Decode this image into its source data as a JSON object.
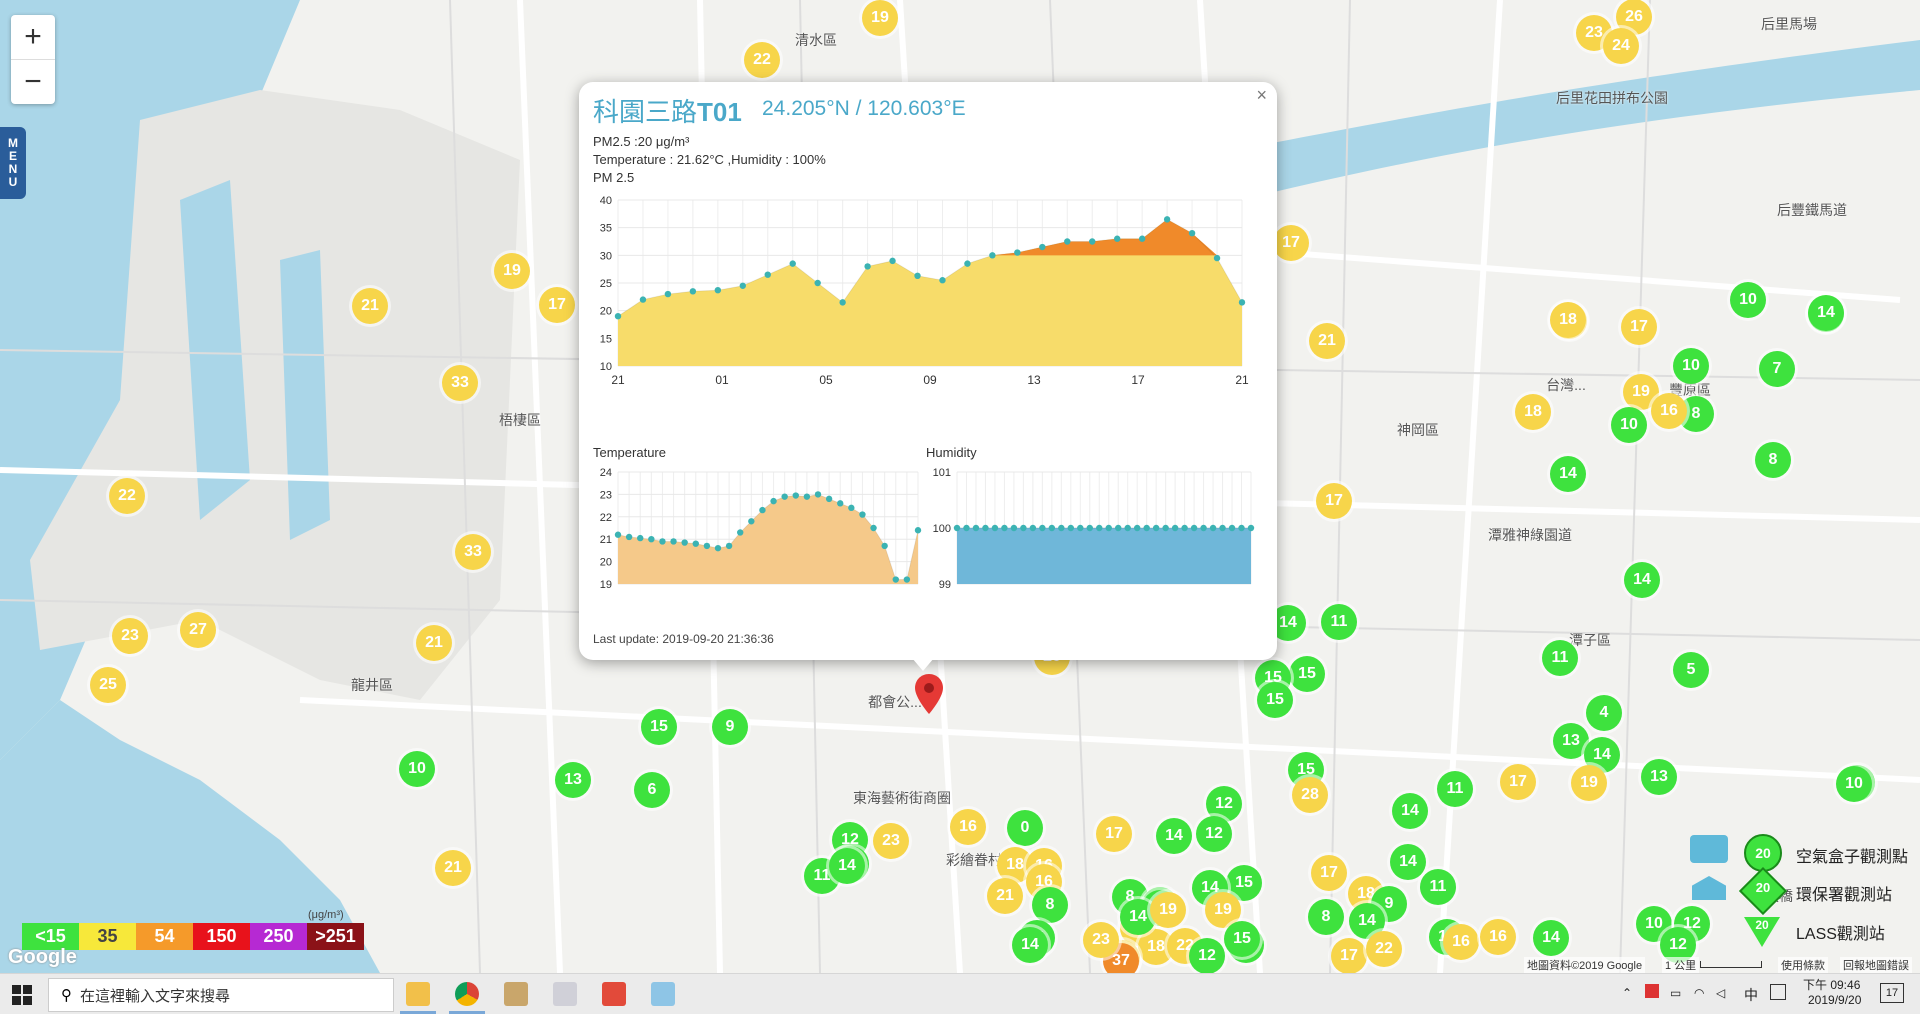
{
  "map": {
    "zoom_in": "+",
    "zoom_out": "−",
    "menu_letters": [
      "M",
      "E",
      "N",
      "U"
    ],
    "places": [
      {
        "t": "清水區"
      },
      {
        "t": "后里馬場"
      },
      {
        "t": "后里花田拼布公園"
      },
      {
        "t": "后豐鐵馬道"
      },
      {
        "t": "梧棲區"
      },
      {
        "t": "神岡區"
      },
      {
        "t": "潭雅神綠園道"
      },
      {
        "t": "台灣..."
      },
      {
        "t": "龍井區"
      },
      {
        "t": "都會公..."
      },
      {
        "t": "東海藝術街商圈"
      },
      {
        "t": "潭子區"
      },
      {
        "t": "豐原區"
      },
      {
        "t": "彩繪眷村"
      },
      {
        "t": "海天橋"
      }
    ],
    "markers": [
      {
        "v": "19",
        "c": "y"
      },
      {
        "v": "22",
        "c": "y"
      },
      {
        "v": "23",
        "c": "y"
      },
      {
        "v": "26",
        "c": "y"
      },
      {
        "v": "24",
        "c": "y"
      },
      {
        "v": "21",
        "c": "y"
      },
      {
        "v": "19",
        "c": "y"
      },
      {
        "v": "17",
        "c": "y"
      },
      {
        "v": "33",
        "c": "y"
      },
      {
        "v": "22",
        "c": "y"
      },
      {
        "v": "33",
        "c": "y"
      },
      {
        "v": "23",
        "c": "y"
      },
      {
        "v": "27",
        "c": "y"
      },
      {
        "v": "21",
        "c": "y"
      },
      {
        "v": "25",
        "c": "y"
      },
      {
        "v": "10",
        "c": "g"
      },
      {
        "v": "13",
        "c": "g"
      },
      {
        "v": "6",
        "c": "g"
      },
      {
        "v": "15",
        "c": "g"
      },
      {
        "v": "9",
        "c": "g"
      },
      {
        "v": "21",
        "c": "y"
      },
      {
        "v": "12",
        "c": "g"
      },
      {
        "v": "17",
        "c": "y"
      },
      {
        "v": "21",
        "c": "y"
      },
      {
        "v": "17",
        "c": "y"
      },
      {
        "v": "16",
        "c": "y"
      },
      {
        "v": "18",
        "c": "y"
      },
      {
        "v": "17",
        "c": "y"
      },
      {
        "v": "18",
        "c": "y"
      },
      {
        "v": "17",
        "c": "y"
      },
      {
        "v": "19",
        "c": "y"
      },
      {
        "v": "10",
        "c": "g"
      },
      {
        "v": "14",
        "c": "g"
      },
      {
        "v": "14",
        "c": "g"
      },
      {
        "v": "10",
        "c": "g"
      },
      {
        "v": "7",
        "c": "g"
      },
      {
        "v": "8",
        "c": "g"
      },
      {
        "v": "16",
        "c": "y"
      },
      {
        "v": "8",
        "c": "g"
      },
      {
        "v": "14",
        "c": "g"
      },
      {
        "v": "10",
        "c": "g"
      },
      {
        "v": "14",
        "c": "g"
      },
      {
        "v": "11",
        "c": "g"
      },
      {
        "v": "14",
        "c": "g"
      },
      {
        "v": "11",
        "c": "g"
      },
      {
        "v": "15",
        "c": "g"
      },
      {
        "v": "5",
        "c": "g"
      },
      {
        "v": "4",
        "c": "g"
      },
      {
        "v": "13",
        "c": "g"
      },
      {
        "v": "14",
        "c": "g"
      },
      {
        "v": "13",
        "c": "g"
      },
      {
        "v": "15",
        "c": "g"
      },
      {
        "v": "15",
        "c": "g"
      },
      {
        "v": "15",
        "c": "g"
      },
      {
        "v": "28",
        "c": "y"
      },
      {
        "v": "12",
        "c": "g"
      },
      {
        "v": "14",
        "c": "g"
      },
      {
        "v": "11",
        "c": "g"
      },
      {
        "v": "19",
        "c": "y"
      },
      {
        "v": "17",
        "c": "y"
      },
      {
        "v": "14",
        "c": "g"
      },
      {
        "v": "18",
        "c": "y"
      },
      {
        "v": "9",
        "c": "g"
      },
      {
        "v": "17",
        "c": "y"
      },
      {
        "v": "11",
        "c": "g"
      },
      {
        "v": "14",
        "c": "g"
      },
      {
        "v": "8",
        "c": "g"
      },
      {
        "v": "14",
        "c": "g"
      },
      {
        "v": "17",
        "c": "y"
      },
      {
        "v": "22",
        "c": "y"
      },
      {
        "v": "16",
        "c": "y"
      },
      {
        "v": "16",
        "c": "y"
      },
      {
        "v": "14",
        "c": "g"
      },
      {
        "v": "10",
        "c": "g"
      },
      {
        "v": "12",
        "c": "g"
      },
      {
        "v": "12",
        "c": "g"
      },
      {
        "v": "14",
        "c": "g"
      },
      {
        "v": "10",
        "c": "g"
      },
      {
        "v": "20",
        "c": "y"
      },
      {
        "v": "15",
        "c": "g"
      },
      {
        "v": "0",
        "c": "g"
      },
      {
        "v": "16",
        "c": "y"
      },
      {
        "v": "12",
        "c": "g"
      },
      {
        "v": "23",
        "c": "y"
      },
      {
        "v": "15",
        "c": "g"
      },
      {
        "v": "11",
        "c": "g"
      },
      {
        "v": "14",
        "c": "g"
      },
      {
        "v": "18",
        "c": "y"
      },
      {
        "v": "16",
        "c": "y"
      },
      {
        "v": "16",
        "c": "y"
      },
      {
        "v": "21",
        "c": "y"
      },
      {
        "v": "8",
        "c": "g"
      },
      {
        "v": "11",
        "c": "g"
      },
      {
        "v": "15",
        "c": "g"
      },
      {
        "v": "16",
        "c": "y"
      },
      {
        "v": "18",
        "c": "y"
      },
      {
        "v": "22",
        "c": "y"
      },
      {
        "v": "14",
        "c": "g"
      },
      {
        "v": "10",
        "c": "g"
      },
      {
        "v": "19",
        "c": "y"
      },
      {
        "v": "16",
        "c": "y"
      },
      {
        "v": "18",
        "c": "y"
      },
      {
        "v": "14",
        "c": "g"
      },
      {
        "v": "15",
        "c": "g"
      },
      {
        "v": "37",
        "c": "o"
      },
      {
        "v": "12",
        "c": "g"
      },
      {
        "v": "14",
        "c": "g"
      },
      {
        "v": "8",
        "c": "g"
      },
      {
        "v": "17",
        "c": "y"
      },
      {
        "v": "12",
        "c": "g"
      },
      {
        "v": "15",
        "c": "g"
      },
      {
        "v": "9",
        "c": "g"
      },
      {
        "v": "14",
        "c": "g"
      },
      {
        "v": "19",
        "c": "y"
      },
      {
        "v": "23",
        "c": "y"
      }
    ]
  },
  "popup": {
    "title_name": "科園三路",
    "title_id": "T01",
    "coords": "24.205°N / 120.603°E",
    "pm_line": "PM2.5 :20 μg/m³",
    "temp_line": "Temperature : 21.62°C ,Humidity : 100%",
    "pm_chart_label": "PM 2.5",
    "temp_chart_label": "Temperature",
    "hum_chart_label": "Humidity",
    "last_update": "Last update: 2019-09-20 21:36:36",
    "close": "×"
  },
  "chart_data": [
    {
      "type": "area",
      "title": "PM 2.5",
      "x": [
        "21",
        "22",
        "23",
        "00",
        "01",
        "02",
        "03",
        "04",
        "05",
        "06",
        "07",
        "08",
        "09",
        "10",
        "11",
        "12",
        "13",
        "14",
        "15",
        "16",
        "17",
        "18",
        "19",
        "20",
        "21"
      ],
      "xticks": [
        "21",
        "01",
        "05",
        "09",
        "13",
        "17",
        "21"
      ],
      "ylim": [
        10,
        40
      ],
      "yticks": [
        10,
        15,
        20,
        25,
        30,
        35,
        40
      ],
      "series": [
        {
          "values": [
            19,
            22,
            23,
            23.5,
            23.7,
            24.5,
            26.5,
            28.5,
            25,
            21.5,
            28,
            29,
            26.3,
            25.5,
            28.5,
            30,
            30.5,
            31.5,
            32.5,
            32.5,
            33,
            33,
            36.5,
            34,
            29.5,
            21.5
          ]
        }
      ],
      "colors": {
        "fill": "#f7dc6a",
        "high_fill": "#f08a2a",
        "dot": "#3bb3b3"
      }
    },
    {
      "type": "area",
      "title": "Temperature",
      "ylim": [
        19,
        24
      ],
      "yticks": [
        19,
        20,
        21,
        22,
        23,
        24
      ],
      "series": [
        {
          "values": [
            21.2,
            21.1,
            21.05,
            21,
            20.9,
            20.9,
            20.85,
            20.8,
            20.7,
            20.6,
            20.7,
            21.3,
            21.8,
            22.3,
            22.7,
            22.9,
            22.95,
            22.9,
            23,
            22.8,
            22.6,
            22.4,
            22.1,
            21.5,
            20.7,
            19.2,
            19.2,
            21.4
          ]
        }
      ],
      "colors": {
        "fill": "#f5c98a",
        "dot": "#3bb3b3"
      }
    },
    {
      "type": "area",
      "title": "Humidity",
      "ylim": [
        99,
        101
      ],
      "yticks": [
        99,
        100,
        101
      ],
      "series": [
        {
          "values": [
            100,
            100,
            100,
            100,
            100,
            100,
            100,
            100,
            100,
            100,
            100,
            100,
            100,
            100,
            100,
            100,
            100,
            100,
            100,
            100,
            100,
            100,
            100,
            100,
            100,
            100,
            100,
            100,
            100,
            100,
            100,
            100
          ]
        }
      ],
      "colors": {
        "fill": "#6fb7d9",
        "dot": "#3bb3b3"
      }
    }
  ],
  "legend": {
    "scale": [
      {
        "label": "<15",
        "color": "#3ee23e"
      },
      {
        "label": "35",
        "color": "#f7e83a"
      },
      {
        "label": "54",
        "color": "#f59a2a"
      },
      {
        "label": "150",
        "color": "#e8121b"
      },
      {
        "label": "250",
        "color": "#b629d3"
      },
      {
        "label": ">251",
        "color": "#8b1218"
      }
    ],
    "unit": "(μg/m³)",
    "stations": [
      {
        "label": "空氣盒子觀測點",
        "icon_value": "20"
      },
      {
        "label": "環保署觀測站",
        "icon_value": "20"
      },
      {
        "label": "LASS觀測站",
        "icon_value": "20"
      }
    ]
  },
  "attribution": {
    "google": "Google",
    "data": "地圖資料©2019 Google",
    "scale": "1 公里",
    "terms": "使用條款",
    "report": "回報地圖錯誤"
  },
  "taskbar": {
    "search_placeholder": "在這裡輸入文字來搜尋",
    "time": "下午 09:46",
    "date": "2019/9/20",
    "ime": "中",
    "notif": "17"
  }
}
